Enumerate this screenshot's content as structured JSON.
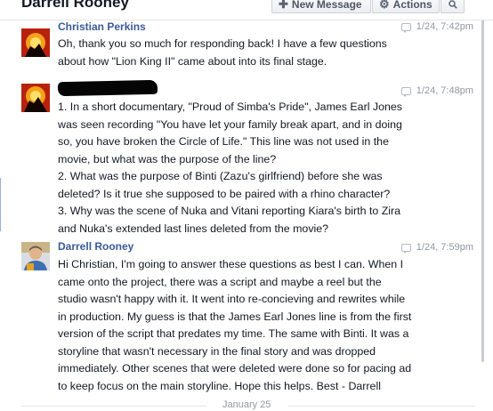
{
  "header": {
    "title": "Darrell Rooney",
    "new_message_label": "New Message",
    "actions_label": "Actions"
  },
  "messages": [
    {
      "sender": "Christian Perkins",
      "time": "1/24, 7:42pm",
      "lines": [
        "Oh, thank you so much for responding back! I have a few questions",
        "about how \"Lion King II\" came about into its final stage."
      ]
    },
    {
      "sender": "",
      "time": "1/24, 7:48pm",
      "lines": [
        "1. In a short documentary, \"Proud of Simba's Pride\", James Earl Jones",
        "was seen recording \"You have let your family break apart, and in doing",
        "so, you have broken the Circle of Life.\" This line was not used in the",
        "movie, but what was the purpose of the line?",
        "2. What was the purpose of Binti (Zazu's girlfriend) before she was",
        "deleted? Is it true she supposed to be paired with a rhino character?",
        "3.  Why was the scene of Nuka and Vitani reporting Kiara's birth to Zira",
        "and Nuka's extended last lines deleted from the movie?"
      ]
    },
    {
      "sender": "Darrell Rooney",
      "time": "1/24, 7:59pm",
      "lines": [
        "Hi Christian, I'm going to answer these questions as best I can. When I",
        "came onto the project, there was a script and maybe a reel but the",
        "studio wasn't happy with it. It went into re-concieving and rewrites while",
        "in production. My guess is that the James Earl Jones line is from the first",
        "version of the script that predates my time. The same with Binti. It was a",
        "storyline that wasn't necessary in the final story and was dropped",
        "immediately. Other scenes that were deleted were done so for pacing ad",
        "to keep focus on the main storyline. Hope this helps. Best - Darrell"
      ]
    }
  ],
  "date_divider": "January 25"
}
